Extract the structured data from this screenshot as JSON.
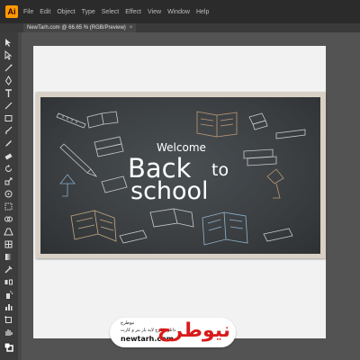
{
  "app": {
    "logo_text": "Ai"
  },
  "menu": [
    "File",
    "Edit",
    "Object",
    "Type",
    "Select",
    "Effect",
    "View",
    "Window",
    "Help"
  ],
  "document_tab": {
    "label": "NewTarh.com @ 66.65 % (RGB/Preview)",
    "close": "×"
  },
  "tools": [
    "selection-tool",
    "direct-selection-tool",
    "magic-wand-tool",
    "pen-tool",
    "type-tool",
    "line-tool",
    "rectangle-tool",
    "paintbrush-tool",
    "pencil-tool",
    "eraser-tool",
    "rotate-tool",
    "scale-tool",
    "warp-tool",
    "free-transform-tool",
    "shape-builder-tool",
    "perspective-tool",
    "mesh-tool",
    "gradient-tool",
    "eyedropper-tool",
    "blend-tool",
    "symbol-sprayer-tool",
    "graph-tool",
    "artboard-tool",
    "slice-tool",
    "hand-tool",
    "zoom-tool"
  ],
  "artwork": {
    "welcome": "Welcome",
    "back": "Back",
    "to": "to",
    "school": "school",
    "board_color": "#3c4043",
    "chalk_color": "#ffffff"
  },
  "watermark": {
    "brand": "نیوطرح",
    "title": "نیوطرح",
    "tagline": "دانلود طرح لایه باز بنر و کارت",
    "domain": "newtarh.com",
    "brand_color": "#d81b1b"
  }
}
